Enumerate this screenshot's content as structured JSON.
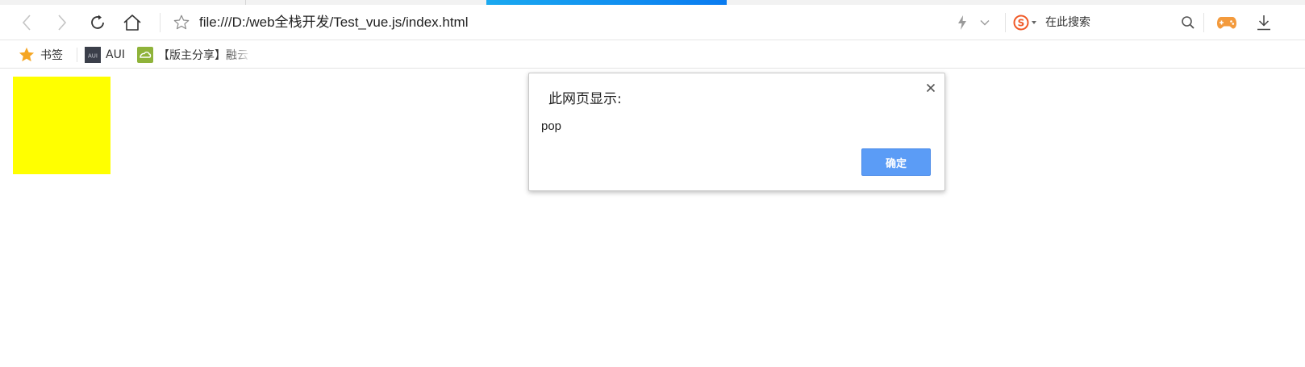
{
  "browser": {
    "address_bar": {
      "url": "file:///D:/web全栈开发/Test_vue.js/index.html"
    },
    "search_box": {
      "placeholder": "在此搜索"
    },
    "bookmarks": [
      {
        "label": "书签",
        "icon": "star-icon"
      },
      {
        "label": "AUI",
        "icon": "aui-favicon-icon"
      },
      {
        "label": "【版主分享】融云",
        "icon": "cloud-favicon-icon"
      }
    ],
    "icons": {
      "back": "chevron-left-icon",
      "forward": "chevron-right-icon",
      "reload": "reload-icon",
      "home": "home-icon",
      "favorite": "star-outline-icon",
      "mode": "lightning-icon",
      "mode_menu": "chevron-down-icon",
      "search_engine": "sogou-logo-icon",
      "search": "search-icon",
      "games": "gamepad-icon",
      "download": "download-icon"
    }
  },
  "dialog": {
    "title": "此网页显示:",
    "message": "pop",
    "ok_label": "确定"
  },
  "colors": {
    "page_box": "#ffff00",
    "tab_indicator": "#0a7bf0",
    "ok_button": "#5b9cf6",
    "bookmark_star": "#f5a623",
    "games_icon": "#f39a3c",
    "sogou_logo": "#f05a28"
  }
}
